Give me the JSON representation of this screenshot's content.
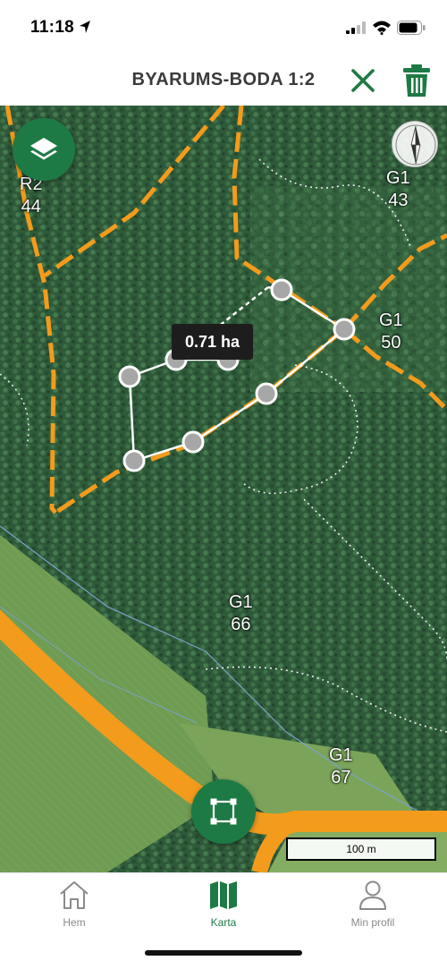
{
  "status_bar": {
    "time": "11:18",
    "icons": [
      "location-arrow-icon",
      "signal-icon",
      "wifi-icon",
      "battery-icon"
    ]
  },
  "header": {
    "title": "BYARUMS-BODA 1:2",
    "close_icon": "close-icon",
    "trash_icon": "trash-icon",
    "accent_color": "#1e7a45"
  },
  "map": {
    "layers_icon": "layers-icon",
    "compass_icon": "compass-icon",
    "stands": [
      {
        "type": "R2",
        "number": "44"
      },
      {
        "type": "G1",
        "number": "43"
      },
      {
        "type": "G1",
        "number": "50"
      },
      {
        "type": "G1",
        "number": "66"
      },
      {
        "type": "G1",
        "number": "67"
      }
    ],
    "drawn_area": "0.71 ha",
    "draw_tool_icon": "polygon-draw-icon",
    "scale": "100 m",
    "colors": {
      "forest": "#2f5a3a",
      "field": "#6e9a4f",
      "road": "#f39b1c",
      "boundary": "#f39b1c"
    }
  },
  "nav": {
    "items": [
      {
        "label": "Hem",
        "icon": "home-icon",
        "active": false
      },
      {
        "label": "Karta",
        "icon": "map-icon",
        "active": true
      },
      {
        "label": "Min profil",
        "icon": "profile-icon",
        "active": false
      }
    ],
    "active_color": "#1e7a45",
    "inactive_color": "#8a8a8a"
  }
}
